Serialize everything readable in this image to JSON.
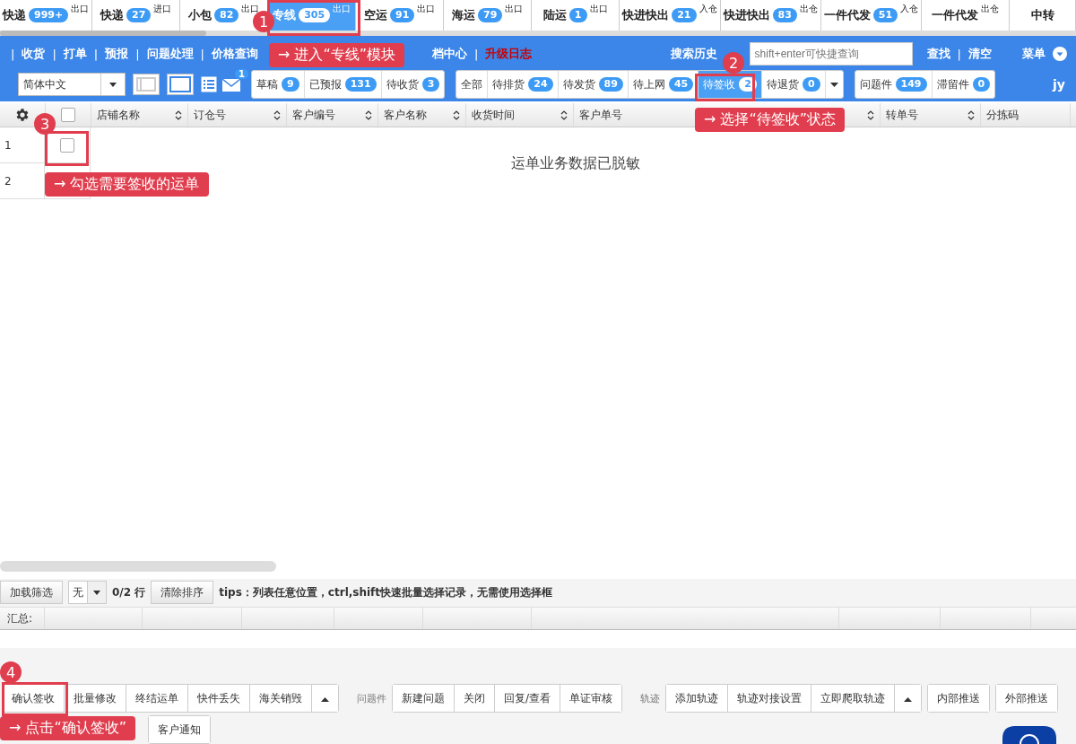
{
  "tabs": [
    {
      "label": "快递",
      "count": "999+",
      "tag": "出口",
      "selected": false
    },
    {
      "label": "快递",
      "count": "27",
      "tag": "进口",
      "selected": false
    },
    {
      "label": "小包",
      "count": "82",
      "tag": "出口",
      "selected": false
    },
    {
      "label": "专线",
      "count": "305",
      "tag": "出口",
      "selected": true
    },
    {
      "label": "空运",
      "count": "91",
      "tag": "出口",
      "selected": false
    },
    {
      "label": "海运",
      "count": "79",
      "tag": "出口",
      "selected": false
    },
    {
      "label": "陆运",
      "count": "1",
      "tag": "出口",
      "selected": false
    },
    {
      "label": "快进快出",
      "count": "21",
      "tag": "入仓",
      "selected": false
    },
    {
      "label": "快进快出",
      "count": "83",
      "tag": "出仓",
      "selected": false
    },
    {
      "label": "一件代发",
      "count": "51",
      "tag": "入仓",
      "selected": false
    },
    {
      "label": "一件代发",
      "tag": "出仓",
      "selected": false
    },
    {
      "label": "中转",
      "selected": false
    }
  ],
  "nav": {
    "items": [
      {
        "sep": "|",
        "label": "收货",
        "highlight": false
      },
      {
        "sep": "|",
        "label": "打单",
        "highlight": false
      },
      {
        "sep": "|",
        "label": "预报",
        "highlight": false
      },
      {
        "sep": "|",
        "label": "问题处理",
        "highlight": false
      },
      {
        "sep": "|",
        "label": "价格查询",
        "highlight": false
      },
      {
        "label": "档中心",
        "highlight": false,
        "covered_before": true
      },
      {
        "sep": "|",
        "label": "升级日志",
        "highlight": true
      }
    ],
    "search_history": "搜索历史",
    "search": {
      "placeholder": "shift+enter可快捷查询"
    },
    "find": "查找",
    "divider": "|",
    "clear": "清空",
    "menu": "菜单"
  },
  "toolbar": {
    "language": "简体中文",
    "mail_badge": "1",
    "user": "jy",
    "status_groups": [
      [
        {
          "label": "草稿",
          "count": "9",
          "selected": false
        },
        {
          "label": "已预报",
          "count": "131",
          "selected": false
        },
        {
          "label": "待收货",
          "count": "3",
          "selected": false
        }
      ],
      [
        {
          "label": "全部",
          "selected": false
        },
        {
          "label": "待排货",
          "count": "24",
          "selected": false
        },
        {
          "label": "待发货",
          "count": "89",
          "selected": false
        },
        {
          "label": "待上网",
          "count": "45",
          "selected": false
        },
        {
          "label": "待签收",
          "count": "2",
          "selected": true
        },
        {
          "label": "待退货",
          "count": "0",
          "selected": false
        },
        {
          "kind": "dropdown",
          "selected": false
        }
      ],
      [
        {
          "label": "问题件",
          "count": "149",
          "selected": false
        },
        {
          "label": "滞留件",
          "count": "0",
          "selected": false
        }
      ]
    ]
  },
  "table": {
    "columns": [
      "店铺名称",
      "订仓号",
      "客户编号",
      "客户名称",
      "收货时间",
      "客户单号",
      "转单号",
      "分拣码"
    ],
    "select_all_checked": false,
    "rows": [
      {
        "number": "1",
        "checked": false
      },
      {
        "number": "2"
      }
    ],
    "message": "运单业务数据已脱敏"
  },
  "footer": {
    "load_filter": "加载筛选",
    "filter_value": "无",
    "row_count": "0/2 行",
    "clear_sort": "清除排序",
    "tips": "**tips**：列表任意位置，ctrl,shift快速批量选择记录，无需使用选择框",
    "summary": "汇总:"
  },
  "actions": [
    {
      "groups": [
        {
          "buttons": [
            {
              "label": "确认签收"
            },
            {
              "label": "批量修改"
            },
            {
              "label": "终结运单"
            },
            {
              "label": "快件丢失"
            },
            {
              "label": "海关销毁"
            },
            {
              "kind": "more"
            }
          ]
        },
        {
          "caption": "问题件",
          "buttons": [
            {
              "label": "新建问题"
            },
            {
              "label": "关闭"
            },
            {
              "label": "回复/查看"
            },
            {
              "label": "单证审核"
            }
          ]
        },
        {
          "caption": "轨迹",
          "buttons": [
            {
              "label": "添加轨迹"
            },
            {
              "label": "轨迹对接设置"
            },
            {
              "label": "立即爬取轨迹"
            },
            {
              "kind": "more"
            }
          ]
        },
        {
          "buttons": [
            {
              "label": "内部推送"
            }
          ]
        },
        {
          "buttons": [
            {
              "label": "外部推送"
            }
          ]
        }
      ]
    },
    {
      "groups": [
        {
          "buttons": [
            {
              "label": "客户通知"
            }
          ]
        }
      ]
    }
  ],
  "callouts": [
    {
      "number": "1",
      "text": "→ 进入“专线”模块"
    },
    {
      "number": "2",
      "text": "→ 选择“待签收”状态"
    },
    {
      "number": "3",
      "text": "→ 勾选需要签收的运单"
    },
    {
      "number": "4",
      "text": "→ 点击“确认签收”"
    }
  ]
}
